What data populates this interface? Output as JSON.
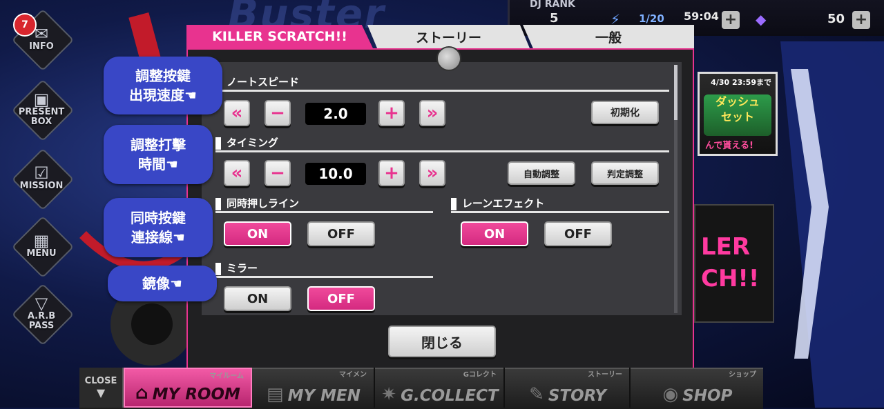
{
  "background": {
    "title_text": "Buster"
  },
  "topbar": {
    "dj_rank_label": "DJ RANK",
    "dj_rank_value": "5",
    "stamina": "1/20",
    "timer": "59:04",
    "gem_count": "50"
  },
  "sidebar": {
    "info_badge": "7",
    "items": [
      {
        "label": "INFO"
      },
      {
        "label": "PRESENT\nBOX"
      },
      {
        "label": "MISSION"
      },
      {
        "label": "MENU"
      },
      {
        "label": "A.R.B\nPASS"
      }
    ]
  },
  "annotations": [
    {
      "text": "調整按鍵\n出現速度☚"
    },
    {
      "text": "調整打擊\n時間☚"
    },
    {
      "text": "同時按鍵\n連接線☚"
    },
    {
      "text": "鏡像☚"
    }
  ],
  "banners": {
    "event_date": "4/30 23:59まで",
    "event_mid_1": "ダッシュ",
    "event_mid_2": "セット",
    "event_foot": "んで貰える!",
    "side_text_1": "LER",
    "side_text_2": "CH!!"
  },
  "modal": {
    "tabs": [
      {
        "label": "KILLER SCRATCH!!",
        "active": true
      },
      {
        "label": "ストーリー",
        "active": false
      },
      {
        "label": "一般",
        "active": false
      }
    ],
    "note_speed": {
      "heading": "ノートスピード",
      "value": "2.0",
      "reset_label": "初期化"
    },
    "timing": {
      "heading": "タイミング",
      "value": "10.0",
      "auto_label": "自動調整",
      "judge_label": "判定調整"
    },
    "simultaneous_line": {
      "heading": "同時押しライン",
      "on_label": "ON",
      "off_label": "OFF",
      "selected": "ON"
    },
    "lane_effect": {
      "heading": "レーンエフェクト",
      "on_label": "ON",
      "off_label": "OFF",
      "selected": "ON"
    },
    "mirror": {
      "heading": "ミラー",
      "on_label": "ON",
      "off_label": "OFF",
      "selected": "OFF"
    },
    "close_label": "閉じる"
  },
  "bottomnav": {
    "close_label": "CLOSE",
    "items": [
      {
        "label": "MY ROOM",
        "sub": "マイルーム",
        "active": true
      },
      {
        "label": "MY MEN",
        "sub": "マイメン",
        "active": false
      },
      {
        "label": "G.COLLECT",
        "sub": "Gコレクト",
        "active": false
      },
      {
        "label": "STORY",
        "sub": "ストーリー",
        "active": false
      },
      {
        "label": "SHOP",
        "sub": "ショップ",
        "active": false
      }
    ]
  },
  "colors": {
    "accent_pink": "#e8338f",
    "annotation_blue": "#3947c6",
    "panel_bg": "#3a3a3e"
  }
}
